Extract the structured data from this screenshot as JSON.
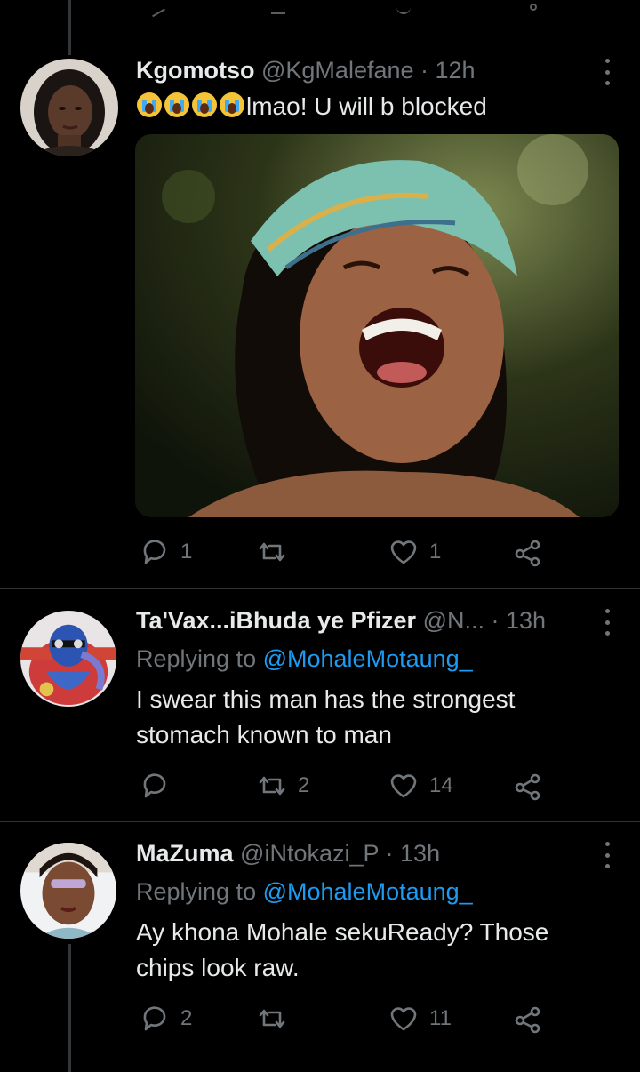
{
  "tweets": [
    {
      "display_name": "Kgomotso",
      "handle": "@KgMalefane",
      "time": "· 12h",
      "emoji_prefix": [
        "loudly-crying-face",
        "loudly-crying-face",
        "loudly-crying-face",
        "loudly-crying-face"
      ],
      "text": "lmao! U will b blocked",
      "media": "photo-laughing-woman-headwrap",
      "counts": {
        "replies": "1",
        "retweets": "",
        "likes": "1"
      }
    },
    {
      "display_name": "Ta'Vax...iBhuda ye Pfizer",
      "handle": "@N...",
      "time": "· 13h",
      "replying_label": "Replying to",
      "replying_to": "@MohaleMotaung_",
      "text": "I swear this man has the strongest stomach known to man",
      "counts": {
        "replies": "",
        "retweets": "2",
        "likes": "14"
      }
    },
    {
      "display_name": "MaZuma",
      "handle": "@iNtokazi_P",
      "time": "· 13h",
      "replying_label": "Replying to",
      "replying_to": "@MohaleMotaung_",
      "text": "Ay khona Mohale sekuReady? Those chips look raw.",
      "counts": {
        "replies": "2",
        "retweets": "",
        "likes": "11"
      }
    }
  ],
  "colors": {
    "background": "#000000",
    "text": "#e7e9ea",
    "secondary": "#71767b",
    "link": "#1d9bf0",
    "divider": "#2f3336"
  },
  "icons": [
    "reply-icon",
    "retweet-icon",
    "like-icon",
    "share-icon",
    "more-icon"
  ]
}
